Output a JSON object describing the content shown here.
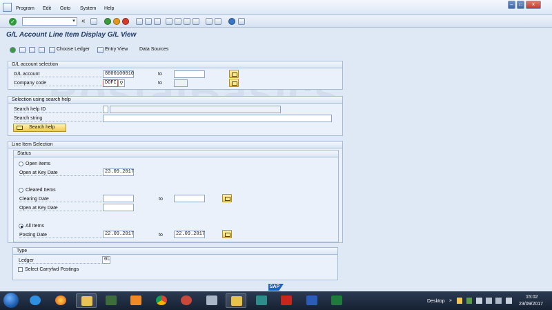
{
  "menu": {
    "items": [
      "Program",
      "Edit",
      "Goto",
      "System",
      "Help"
    ]
  },
  "toolbar": {
    "command_value": "",
    "back_symbol": "«"
  },
  "page": {
    "title": "G/L Account Line Item Display G/L View"
  },
  "app_toolbar": {
    "choose_ledger": "Choose Ledger",
    "entry_view": "Entry View",
    "data_sources": "Data Sources"
  },
  "watermark": "PostalBasics",
  "gl_selection": {
    "title": "G/L account selection",
    "account_label": "G/L account",
    "account_value": "8800100010",
    "to_label": "to",
    "account_to_value": "",
    "company_label": "Company code",
    "company_value": "DOFI",
    "company_to_value": ""
  },
  "search_help": {
    "title": "Selection using search help",
    "id_label": "Search help ID",
    "string_label": "Search string",
    "button_label": "Search help"
  },
  "line_items": {
    "title": "Line Item Selection",
    "status_title": "Status",
    "open_items_label": "Open Items",
    "open_key_date_label": "Open at Key Date",
    "open_key_date_value": "23.09.2017",
    "cleared_items_label": "Cleared Items",
    "clearing_date_label": "Clearing Date",
    "clearing_from": "",
    "clearing_to": "",
    "to_label": "to",
    "cleared_key_date_label": "Open at Key Date",
    "cleared_key_date_value": "",
    "all_items_label": "All Items",
    "posting_date_label": "Posting Date",
    "posting_from": "22.09.2017",
    "posting_to": "22.09.2017",
    "selected_status": "All Items"
  },
  "type": {
    "title": "Type",
    "ledger_label": "Ledger",
    "ledger_value": "0L",
    "carryfwd_label": "Select Carryfwd Postings"
  },
  "status_bar": {
    "logo": "SAP"
  },
  "taskbar": {
    "desktop_label": "Desktop",
    "time": "15:02",
    "date": "23/09/2017",
    "apps": [
      "ie-icon",
      "firefox-icon",
      "explorer-icon",
      "sap-gui-icon",
      "media-player-icon",
      "chrome-icon",
      "snipping-tool-icon",
      "calculator-icon",
      "sap-logon-icon",
      "ca-icon",
      "acrobat-icon",
      "word-icon",
      "excel-icon"
    ]
  }
}
